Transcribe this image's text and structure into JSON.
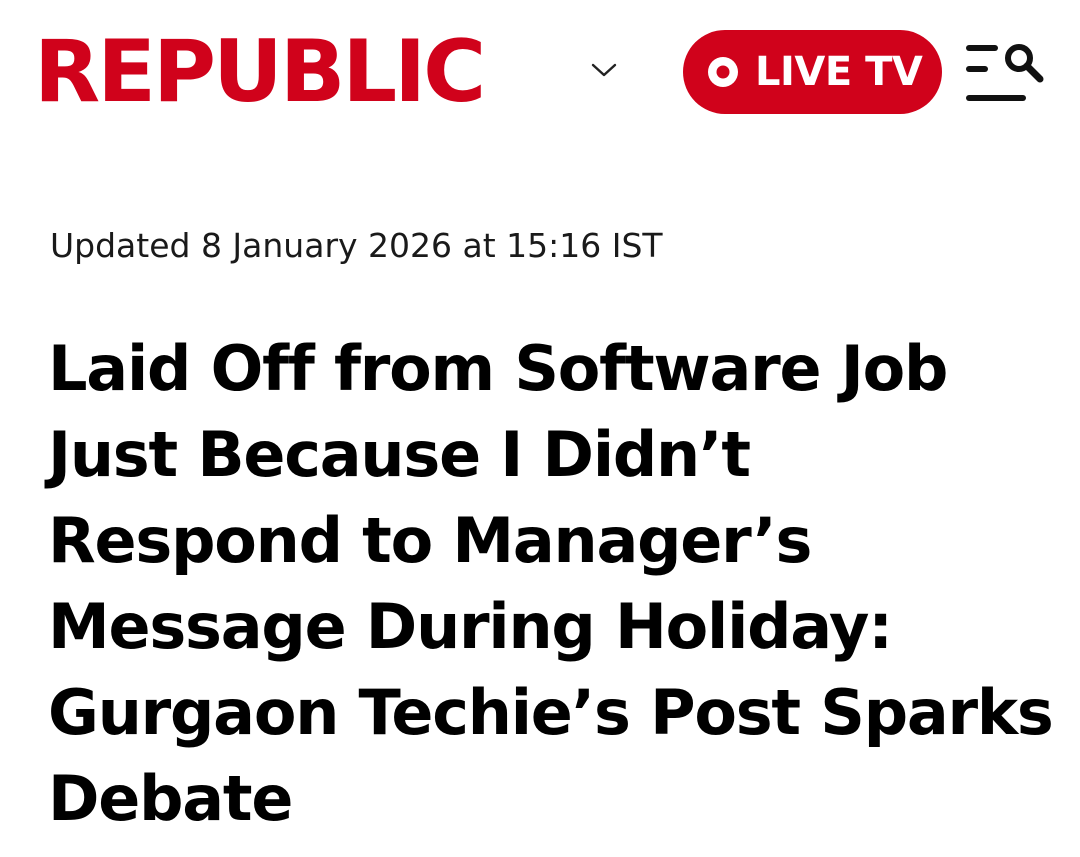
{
  "header": {
    "logo_text": "REPUBLIC",
    "live_label": "LIVE TV",
    "brand_color": "#d0021b",
    "icons": {
      "edition_toggle": "chevron-down-icon",
      "live_indicator": "record-dot-icon",
      "menu_search": "menu-search-icon"
    }
  },
  "article": {
    "updated": "Updated 8 January 2026 at 15:16 IST",
    "headline": "Laid Off from Software Job Just Because I Didn’t Respond to Manager’s Message During Holiday: Gurgaon Techie’s Post Sparks Debate"
  }
}
